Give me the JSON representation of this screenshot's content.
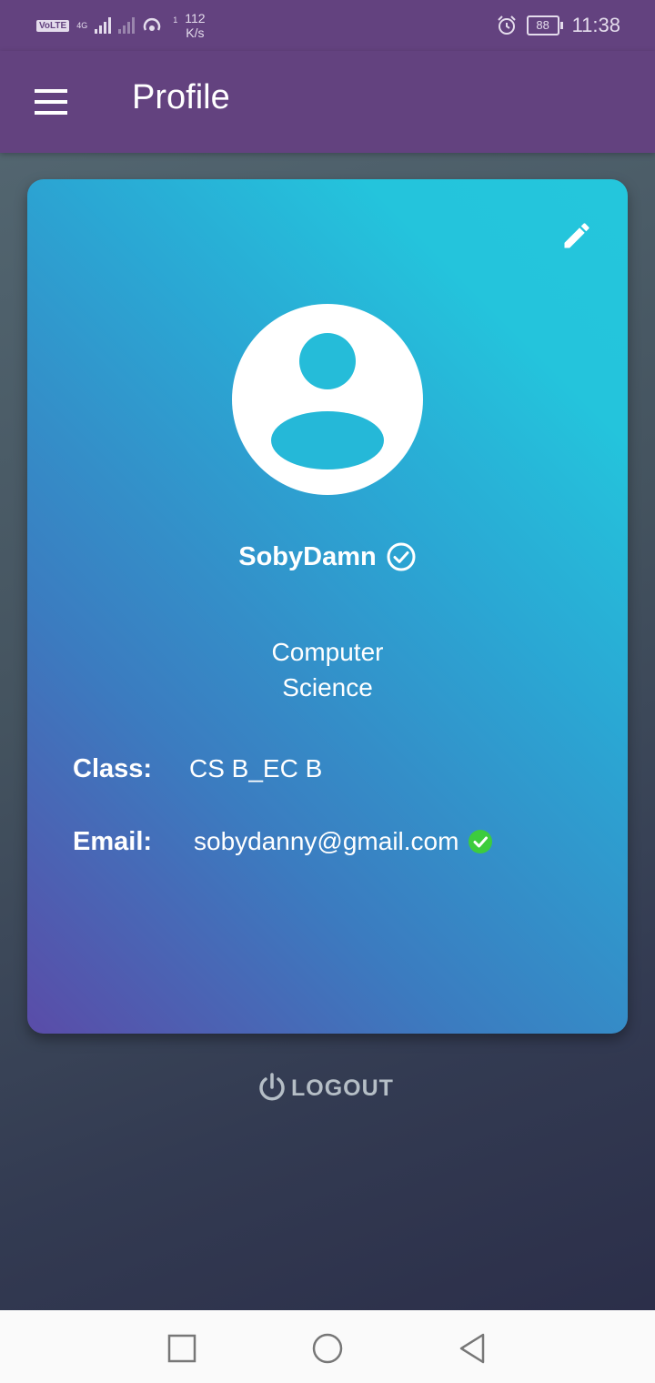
{
  "status_bar": {
    "volte": "VoLTE",
    "network": "4G",
    "hotspot_count": "1",
    "speed_value": "112",
    "speed_unit": "K/s",
    "battery": "88",
    "time": "11:38"
  },
  "app_bar": {
    "title": "Profile",
    "menu_icon": "menu-icon"
  },
  "profile": {
    "name": "SobyDamn",
    "department_line1": "Computer",
    "department_line2": "Science",
    "class_label": "Class:",
    "class_value": "CS B_EC B",
    "email_label": "Email:",
    "email_value": "sobydanny@gmail.com"
  },
  "logout": {
    "label": "LOGOUT"
  },
  "colors": {
    "app_bar": "#63427f",
    "card_start": "#5a4ca8",
    "card_end": "#24c6dc",
    "verified_green": "#3dcc3d"
  },
  "icons": [
    "menu-icon",
    "pencil-icon",
    "avatar-icon",
    "check-circle-icon",
    "green-check-icon",
    "power-icon",
    "square-icon",
    "circle-icon",
    "triangle-back-icon"
  ]
}
